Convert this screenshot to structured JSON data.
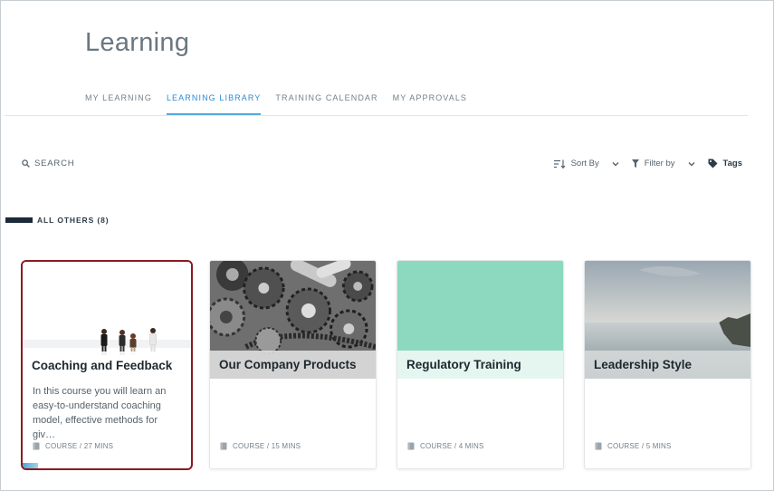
{
  "page": {
    "title": "Learning"
  },
  "tabs": [
    {
      "label": "MY LEARNING"
    },
    {
      "label": "LEARNING LIBRARY"
    },
    {
      "label": "TRAINING CALENDAR"
    },
    {
      "label": "MY APPROVALS"
    }
  ],
  "active_tab": "LEARNING LIBRARY",
  "search": {
    "label": "SEARCH"
  },
  "toolbar": {
    "sort_label": "Sort By",
    "filter_label": "Filter by",
    "tags_label": "Tags"
  },
  "section": {
    "title": "ALL OTHERS (8)"
  },
  "cards": [
    {
      "title": "Coaching and Feedback",
      "description": "In this course you will learn an easy-to-understand coaching model, effective methods for giv…",
      "meta": "COURSE / 27 MINS",
      "progress": 0.09,
      "selected": true
    },
    {
      "title": "Our Company Products",
      "description": "",
      "meta": "COURSE / 15 MINS"
    },
    {
      "title": "Regulatory Training",
      "description": "",
      "meta": "COURSE / 4 MINS"
    },
    {
      "title": "Leadership Style",
      "description": "",
      "meta": "COURSE / 5 MINS"
    }
  ],
  "colors": {
    "accent": "#2b8ad4",
    "selected_border": "#8a1a23",
    "regulatory_bg": "#8cd9bf",
    "section_bar": "#1a2a3a"
  }
}
